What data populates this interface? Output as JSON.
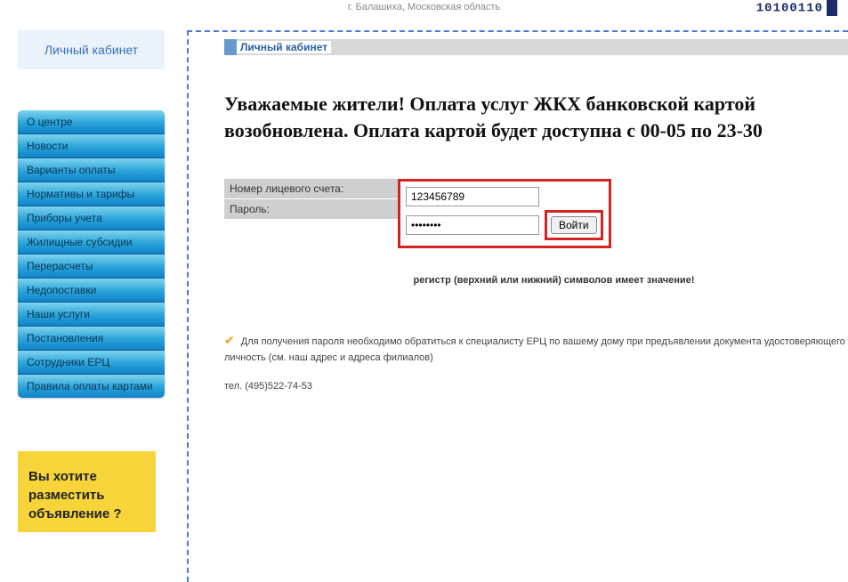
{
  "header": {
    "location": "г. Балашиха, Московская область",
    "logo_text": "10100110"
  },
  "sidebar": {
    "lk_title": "Личный кабинет",
    "menu": [
      {
        "label": "О центре"
      },
      {
        "label": "Новости"
      },
      {
        "label": "Варианты оплаты"
      },
      {
        "label": "Нормативы и тарифы"
      },
      {
        "label": "Приборы учета"
      },
      {
        "label": "Жилищные субсидии"
      },
      {
        "label": "Перерасчеты"
      },
      {
        "label": "Недопоставки"
      },
      {
        "label": "Наши услуги"
      },
      {
        "label": "Постановления"
      },
      {
        "label": "Сотрудники ЕРЦ"
      },
      {
        "label": "Правила оплаты картами"
      }
    ],
    "ad": {
      "line1": "Вы хотите",
      "line2": "разместить",
      "line3": "объявление ?"
    }
  },
  "main": {
    "section_title": "Личный кабинет",
    "notice": "Уважаемые жители! Оплата услуг ЖКХ банковской картой возобновлена. Оплата картой будет доступна с 00-05 по 23-30",
    "login": {
      "account_label": "Номер лицевого счета:",
      "password_label": "Пароль:",
      "account_value": "123456789",
      "password_placeholder": "",
      "password_dots": "●●●●●●●●",
      "submit": "Войти"
    },
    "case_warning": "регистр (верхний или нижний) символов имеет значение!",
    "help_text": "Для получения пароля необходимо обратиться к специалисту ЕРЦ по вашему дому при предъявлении документа удостоверяющего личность (см. наш адрес и адреса филиалов)",
    "phone": "тел. (495)522-74-53"
  }
}
